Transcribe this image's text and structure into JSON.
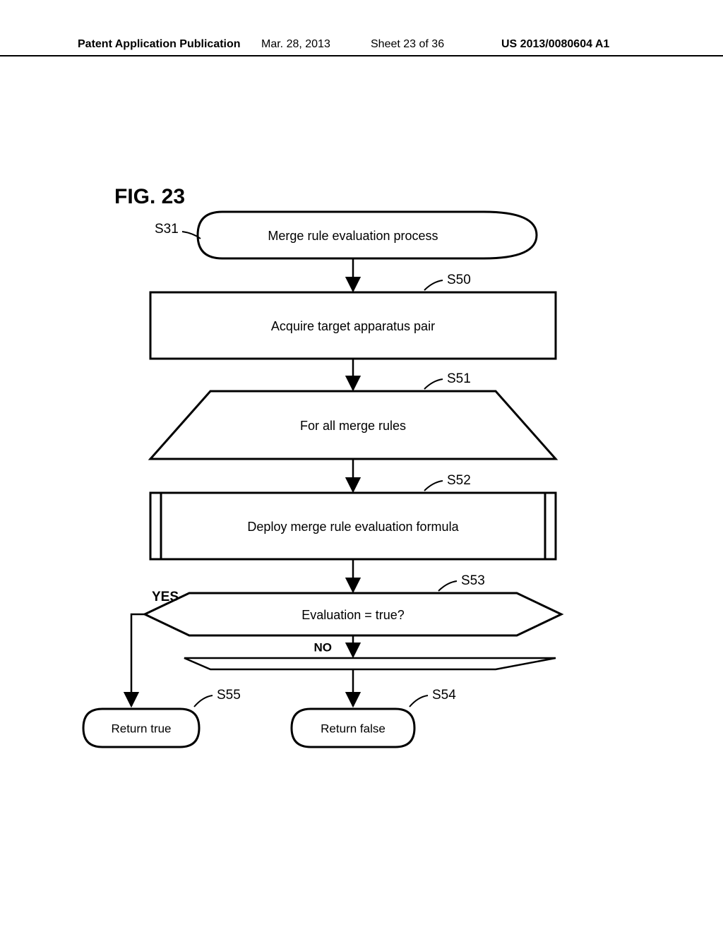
{
  "header": {
    "left": "Patent Application Publication",
    "date": "Mar. 28, 2013",
    "sheet": "Sheet 23 of 36",
    "pubno": "US 2013/0080604 A1"
  },
  "figure_label": "FIG. 23",
  "steps": {
    "s31": {
      "id": "S31",
      "text": "Merge rule evaluation process"
    },
    "s50": {
      "id": "S50",
      "text": "Acquire target apparatus pair"
    },
    "s51": {
      "id": "S51",
      "text": "For all merge rules"
    },
    "s52": {
      "id": "S52",
      "text": "Deploy merge rule evaluation formula"
    },
    "s53": {
      "id": "S53",
      "text": "Evaluation = true?"
    },
    "s54": {
      "id": "S54",
      "text": "Return false"
    },
    "s55": {
      "id": "S55",
      "text": "Return true"
    }
  },
  "branches": {
    "yes": "YES",
    "no": "NO"
  }
}
